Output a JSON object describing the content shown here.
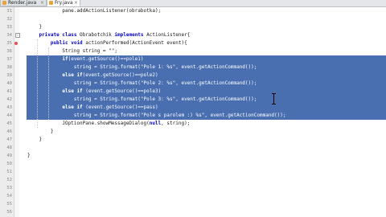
{
  "tabs": [
    {
      "label": "Render.java",
      "active": false
    },
    {
      "label": "Fry.java",
      "active": true
    }
  ],
  "lines": [
    {
      "num": "31",
      "text": "            pane.addActionListener(obrabotka);",
      "sel": false,
      "bp": false,
      "fold": false
    },
    {
      "num": "32",
      "text": "",
      "sel": false,
      "bp": false,
      "fold": false
    },
    {
      "num": "33",
      "text": "    }",
      "sel": false,
      "bp": false,
      "fold": false
    },
    {
      "num": "34",
      "text": "    private class Obrabotchik implements ActionListener{",
      "sel": false,
      "bp": false,
      "fold": true
    },
    {
      "num": "35",
      "text": "        public void actionPerformed(ActionEvent event){",
      "sel": false,
      "bp": true,
      "fold": true
    },
    {
      "num": "36",
      "text": "            String string = \"\";",
      "sel": false,
      "bp": false,
      "fold": false
    },
    {
      "num": "37",
      "text": "            if(event.getSource()==pole1)",
      "sel": true,
      "bp": false,
      "fold": false
    },
    {
      "num": "38",
      "text": "                string = String.format(\"Pole 1: %s\", event.getActionCommand());",
      "sel": true,
      "bp": false,
      "fold": false
    },
    {
      "num": "39",
      "text": "            else if(event.getSource()==pole2)",
      "sel": true,
      "bp": false,
      "fold": false
    },
    {
      "num": "40",
      "text": "                string = String.format(\"Pole 2: %s\", event.getActionCommand());",
      "sel": true,
      "bp": false,
      "fold": false
    },
    {
      "num": "41",
      "text": "            else if (event.getSource()==pole3)",
      "sel": true,
      "bp": false,
      "fold": false
    },
    {
      "num": "42",
      "text": "                string = String.format(\"Pole 3: %s\", event.getActionCommand());",
      "sel": true,
      "bp": false,
      "fold": false
    },
    {
      "num": "43",
      "text": "            else if (event.getSource()==pass)",
      "sel": true,
      "bp": false,
      "fold": false
    },
    {
      "num": "44",
      "text": "                string = String.format(\"Pole s parolem :) %s\", event.getActionCommand());",
      "sel": true,
      "bp": false,
      "fold": false
    },
    {
      "num": "45",
      "text": "            JOptionPane.showMessageDialog(null, string);",
      "sel": false,
      "bp": false,
      "fold": false
    },
    {
      "num": "46",
      "text": "        }",
      "sel": false,
      "bp": false,
      "fold": false
    },
    {
      "num": "47",
      "text": "    }",
      "sel": false,
      "bp": false,
      "fold": false
    },
    {
      "num": "48",
      "text": "",
      "sel": false,
      "bp": false,
      "fold": false
    },
    {
      "num": "49",
      "text": "}",
      "sel": false,
      "bp": false,
      "fold": false
    },
    {
      "num": "50",
      "text": "",
      "sel": false,
      "bp": false,
      "fold": false
    },
    {
      "num": "51",
      "text": "",
      "sel": false,
      "bp": false,
      "fold": false
    },
    {
      "num": "52",
      "text": "",
      "sel": false,
      "bp": false,
      "fold": false
    },
    {
      "num": "53",
      "text": "",
      "sel": false,
      "bp": false,
      "fold": false
    },
    {
      "num": "54",
      "text": "",
      "sel": false,
      "bp": false,
      "fold": false
    },
    {
      "num": "55",
      "text": "",
      "sel": false,
      "bp": false,
      "fold": false
    },
    {
      "num": "56",
      "text": "",
      "sel": false,
      "bp": false,
      "fold": false
    }
  ],
  "colors": {
    "selection": "#4a6fb0",
    "gutter": "#ececec",
    "breakpoint": "#d9534f",
    "keyword": "#0000c8"
  },
  "icons": {
    "tab_icon": "java-file-icon",
    "tab_close": "close-icon",
    "breakpoint": "breakpoint-icon",
    "fold": "fold-toggle-icon",
    "cursor": "text-cursor-icon"
  }
}
